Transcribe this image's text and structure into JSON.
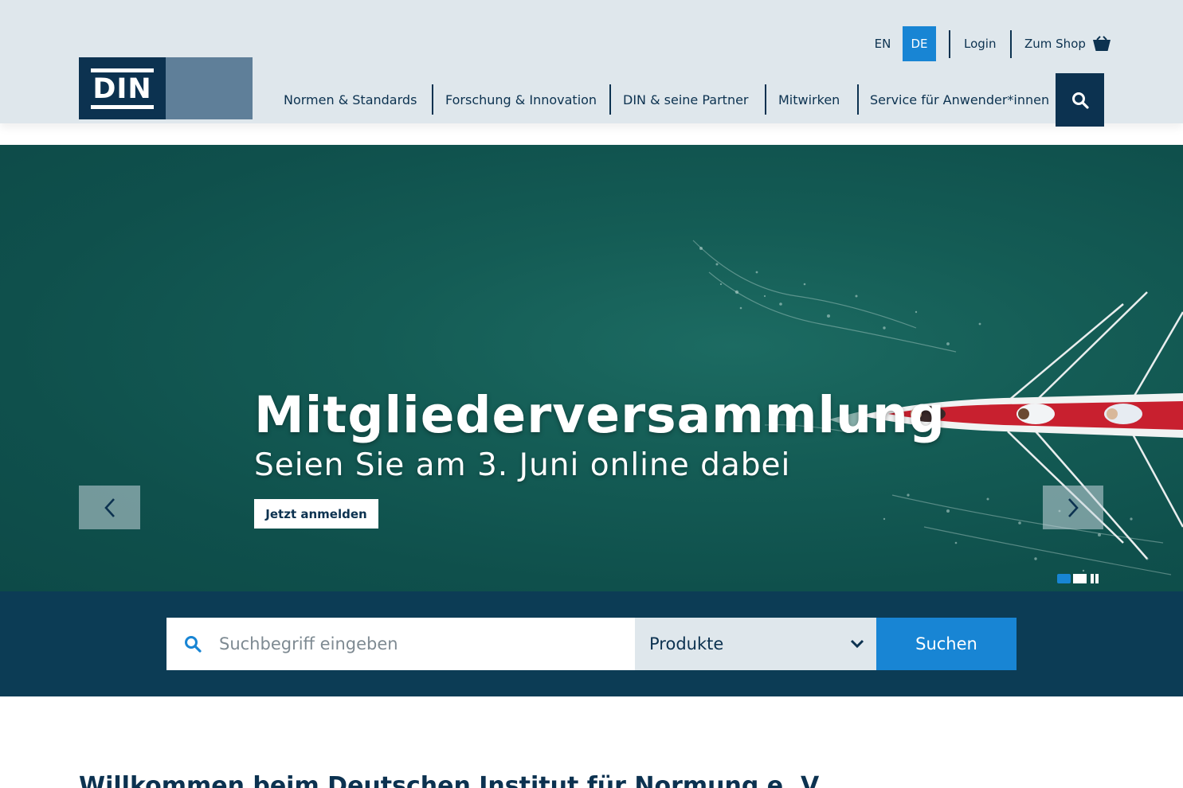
{
  "header": {
    "logo_text": "DIN",
    "languages": [
      {
        "label": "EN",
        "active": false
      },
      {
        "label": "DE",
        "active": true
      }
    ],
    "login_label": "Login",
    "shop_label": "Zum Shop",
    "nav": [
      {
        "label": "Normen & Standards"
      },
      {
        "label": "Forschung & Innovation"
      },
      {
        "label": "DIN & seine Partner"
      },
      {
        "label": "Mitwirken"
      },
      {
        "label": "Service für Anwender*innen"
      }
    ]
  },
  "hero": {
    "title": "Mitgliederversammlung",
    "subtitle": "Seien Sie am 3. Juni online dabei",
    "cta_label": "Jetzt anmelden",
    "slide_count": 2,
    "active_slide": 1
  },
  "search": {
    "placeholder": "Suchbegriff eingeben",
    "value": "",
    "category_selected": "Produkte",
    "submit_label": "Suchen"
  },
  "welcome": {
    "heading": "Willkommen beim Deutschen Institut für Normung e. V."
  },
  "colors": {
    "brand_navy": "#0c3250",
    "accent_blue": "#1885d4",
    "header_bg": "#dfe7ec",
    "search_band_bg": "#0c3c55",
    "logo_light": "#5f7f99"
  },
  "icons": {
    "search": "search-icon",
    "basket": "basket-icon",
    "prev": "chevron-left-icon",
    "next": "chevron-right-icon",
    "dropdown": "chevron-down-icon",
    "pause": "pause-icon"
  }
}
